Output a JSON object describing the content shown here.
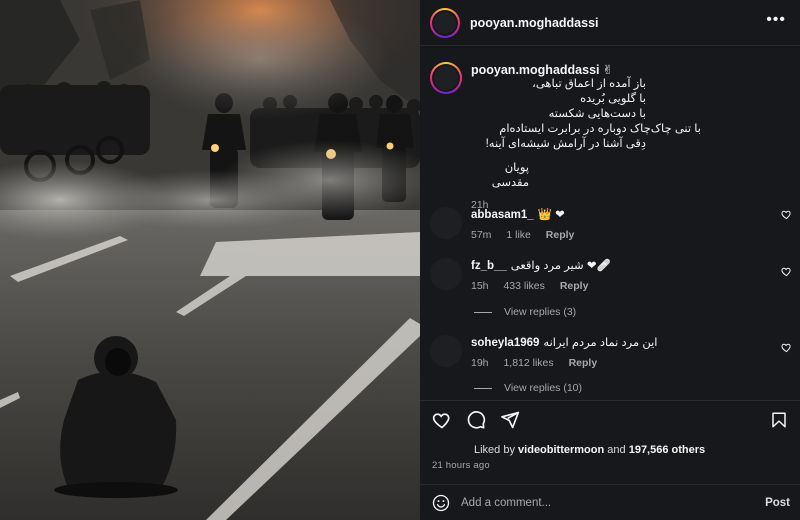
{
  "header": {
    "username": "pooyan.moghaddassi",
    "more_icon": "more-horizontal-icon"
  },
  "caption": {
    "username": "pooyan.moghaddassi",
    "badge": "✌",
    "lines": [
      "باز آمده از اعماق تباهی،",
      "با گلویی بُریده",
      "با دست‌هایی شکسته",
      "با تنی چاک‌چاک دوباره در برابرت ایستاده‌ام",
      "دِقی آشنا در آرامش شیشه‌ای آینه!",
      "",
      "پویان مقدسی"
    ],
    "time": "21h"
  },
  "comments": [
    {
      "user": "abbasam1_",
      "text": "👑 ❤",
      "time": "57m",
      "likes": "1 like",
      "reply": "Reply",
      "view_replies": ""
    },
    {
      "user": "fz_b__",
      "text": "شیر مرد واقعی ❤🩹",
      "time": "15h",
      "likes": "433 likes",
      "reply": "Reply",
      "view_replies": "View replies (3)"
    },
    {
      "user": "soheyla1969",
      "text": "این مرد نماد مردم ایرانه",
      "time": "19h",
      "likes": "1,812 likes",
      "reply": "Reply",
      "view_replies": "View replies (10)"
    }
  ],
  "actions": {
    "liked_by_prefix": "Liked by",
    "liked_by_user": "videobittermoon",
    "liked_by_and": "and",
    "liked_by_count": "197,566 others",
    "timestamp": "21 hours ago"
  },
  "add_comment": {
    "placeholder": "Add a comment...",
    "post_label": "Post"
  },
  "colors": {
    "panel_bg": "#17181c",
    "heart_red": "#ed4956",
    "muted_text": "#a8a8a8"
  }
}
